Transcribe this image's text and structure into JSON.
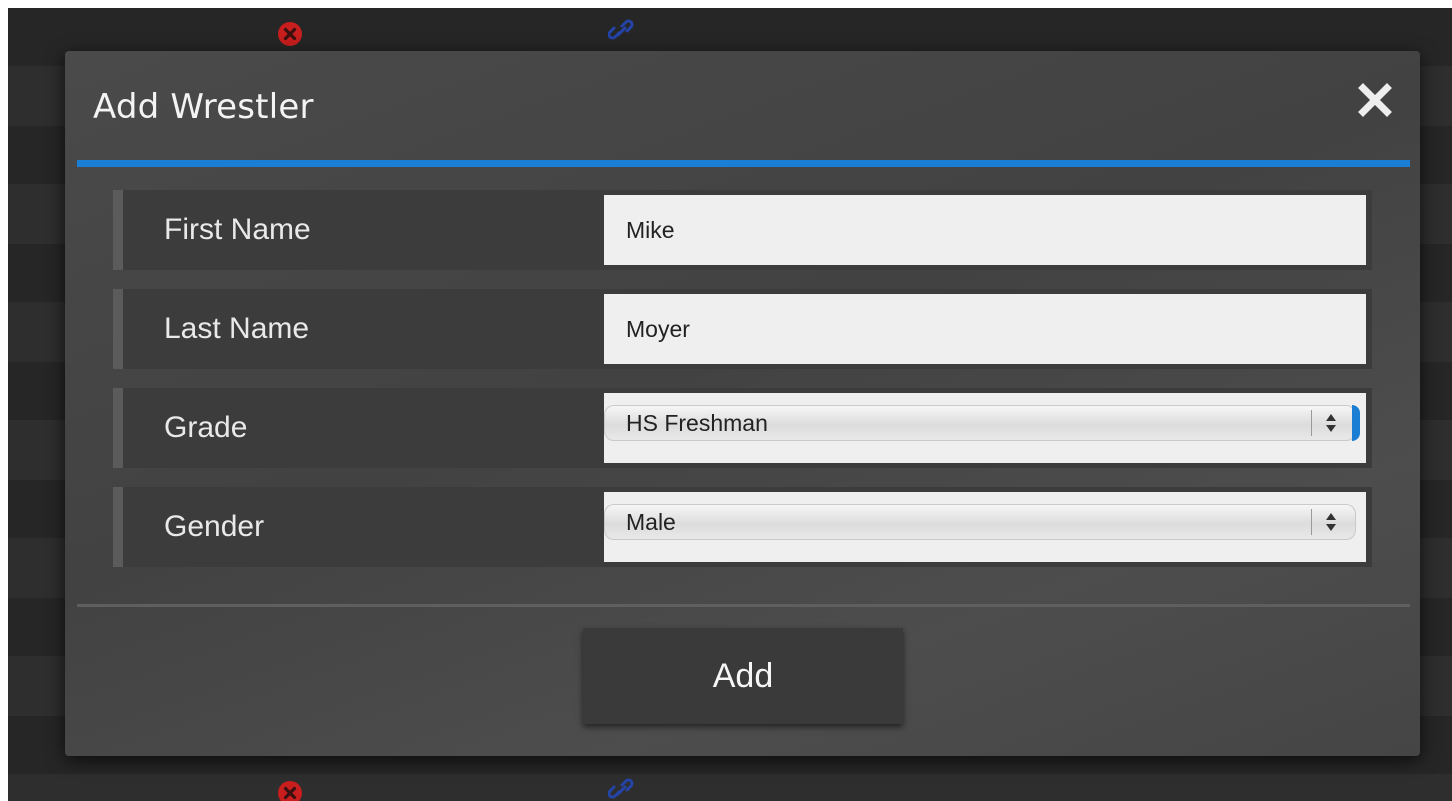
{
  "modal": {
    "title": "Add Wrestler",
    "close_icon": "close-icon"
  },
  "form": {
    "first_name": {
      "label": "First Name",
      "value": "Mike"
    },
    "last_name": {
      "label": "Last Name",
      "value": "Moyer"
    },
    "grade": {
      "label": "Grade",
      "selected": "HS Freshman"
    },
    "gender": {
      "label": "Gender",
      "selected": "Male"
    }
  },
  "actions": {
    "add_label": "Add"
  },
  "background_rows": {
    "icons": [
      "remove-circle-icon",
      "link-icon"
    ]
  },
  "colors": {
    "accent": "#1a7fd4",
    "remove_icon": "#c81e1e",
    "link_icon": "#2544a8"
  }
}
